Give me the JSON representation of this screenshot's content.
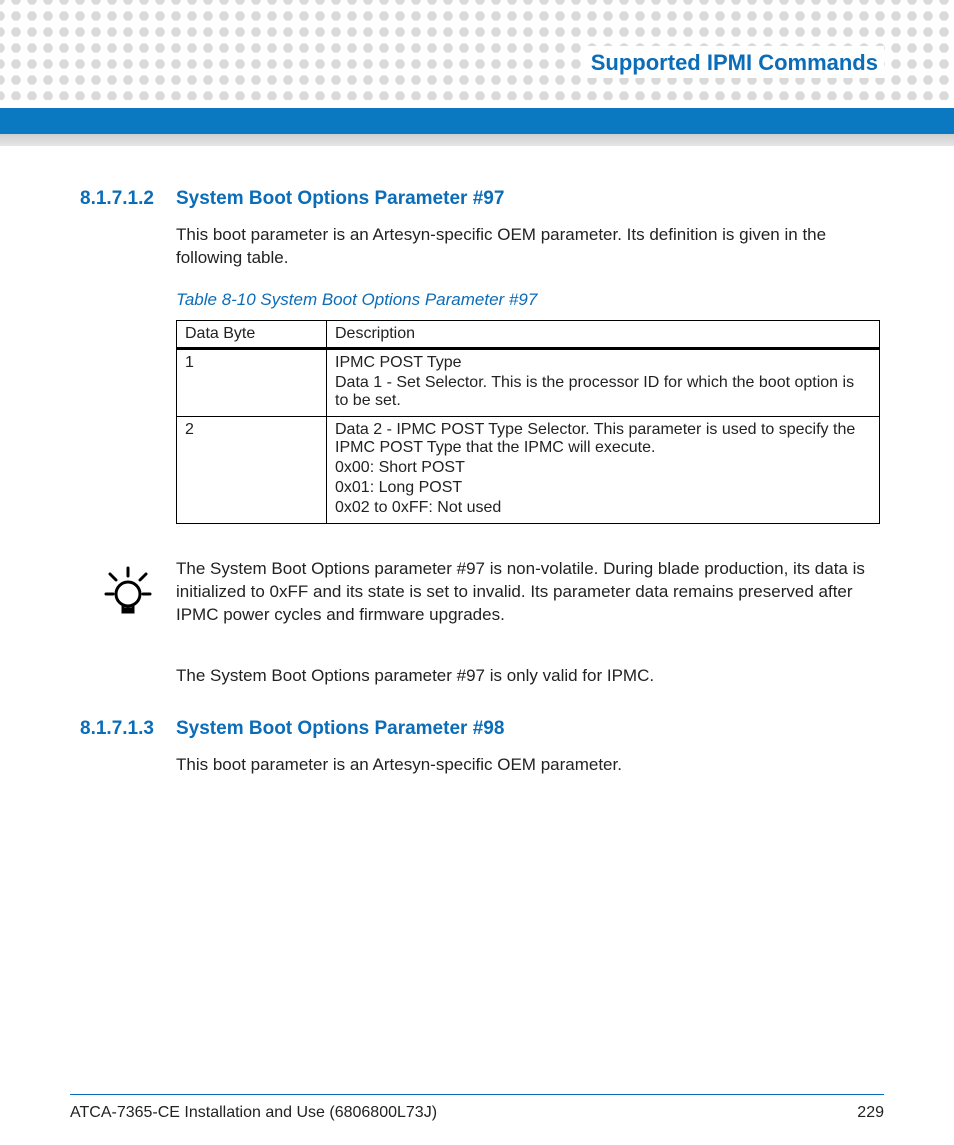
{
  "header": {
    "title": "Supported IPMI Commands"
  },
  "section1": {
    "number": "8.1.7.1.2",
    "title": "System Boot Options Parameter #97",
    "intro": "This boot parameter is an Artesyn-specific OEM parameter. Its definition is given in the following table.",
    "tableCaption": "Table 8-10 System Boot Options Parameter #97",
    "tableHeaders": {
      "c1": "Data Byte",
      "c2": "Description"
    },
    "row1": {
      "byte": "1",
      "l1": "IPMC POST Type",
      "l2": "Data 1 - Set Selector. This is the processor ID for which the boot option is to be set."
    },
    "row2": {
      "byte": "2",
      "l1": "Data 2 - IPMC POST Type Selector. This parameter is used to specify the IPMC POST Type that the IPMC will execute.",
      "l2": "0x00: Short POST",
      "l3": "0x01: Long POST",
      "l4": "0x02 to 0xFF: Not used"
    },
    "tip": "The System Boot Options parameter #97 is non-volatile. During blade production, its data is initialized to 0xFF and its state is set to invalid. Its parameter data remains preserved after IPMC power cycles and firmware upgrades.",
    "note": "The System Boot Options parameter #97 is only valid for IPMC."
  },
  "section2": {
    "number": "8.1.7.1.3",
    "title": "System Boot Options Parameter #98",
    "intro": "This boot parameter is an Artesyn-specific OEM parameter."
  },
  "footer": {
    "left": "ATCA-7365-CE Installation and Use (6806800L73J)",
    "page": "229"
  }
}
